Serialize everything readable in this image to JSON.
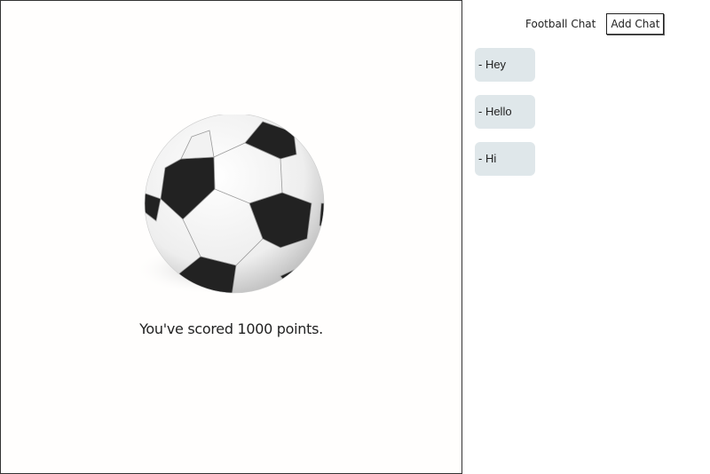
{
  "game": {
    "score_text": "You've scored 1000 points.",
    "ball_icon": "soccer-ball-icon"
  },
  "chat": {
    "title": "Football Chat",
    "add_button_label": "Add Chat",
    "messages": [
      {
        "text": "- Hey"
      },
      {
        "text": "- Hello"
      },
      {
        "text": "- Hi"
      }
    ]
  },
  "colors": {
    "bubble_bg": "#dfe7ea",
    "panel_border": "#333333",
    "text": "#222222"
  }
}
